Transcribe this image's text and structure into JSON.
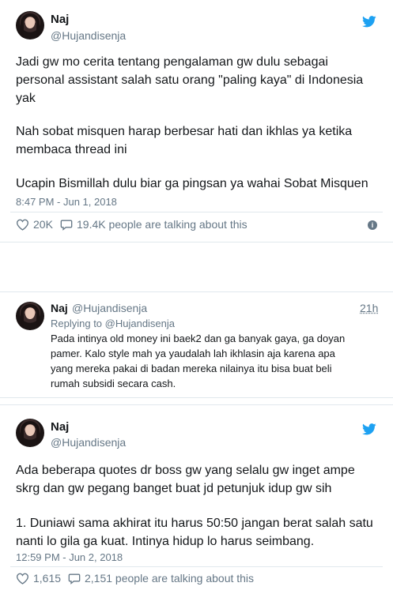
{
  "colors": {
    "accent": "#1da1f2",
    "secondary_text": "#657786",
    "border": "#e1e8ed"
  },
  "tweet1": {
    "name": "Naj",
    "handle": "@Hujandisenja",
    "icon": "twitter-bird-icon",
    "text_lines": [
      "Jadi gw mo cerita tentang pengalaman gw dulu sebagai",
      "personal assistant salah satu orang \"paling kaya\" di Indonesia",
      "yak",
      "",
      "Nah sobat misquen harap berbesar hati dan ikhlas ya ketika",
      "membaca thread ini",
      "",
      "Ucapin Bismillah dulu biar ga pingsan ya wahai Sobat Misquen"
    ],
    "timestamp": "8:47 PM - Jun 1, 2018",
    "likes": "20K",
    "talking": "19.4K people are talking about this"
  },
  "reply": {
    "name": "Naj",
    "handle": "@Hujandisenja",
    "time": "21h",
    "replying_to": "Replying to @Hujandisenja",
    "text_lines": [
      "Pada intinya old money ini baek2 dan ga banyak gaya, ga doyan",
      "pamer. Kalo style mah ya yaudalah lah ikhlasin aja karena apa",
      "yang mereka pakai di badan mereka nilainya itu bisa buat beli",
      "rumah subsidi secara cash."
    ]
  },
  "tweet2": {
    "name": "Naj",
    "handle": "@Hujandisenja",
    "icon": "twitter-bird-icon",
    "text_lines": [
      "Ada beberapa quotes dr boss gw yang selalu gw inget ampe",
      "skrg dan gw pegang banget buat jd petunjuk idup gw sih",
      "",
      "1. Duniawi sama akhirat itu harus 50:50 jangan berat salah satu",
      "nanti lo gila ga kuat. Intinya hidup lo harus seimbang."
    ],
    "timestamp": "12:59 PM - Jun 2, 2018",
    "likes": "1,615",
    "talking": "2,151 people are talking about this"
  }
}
